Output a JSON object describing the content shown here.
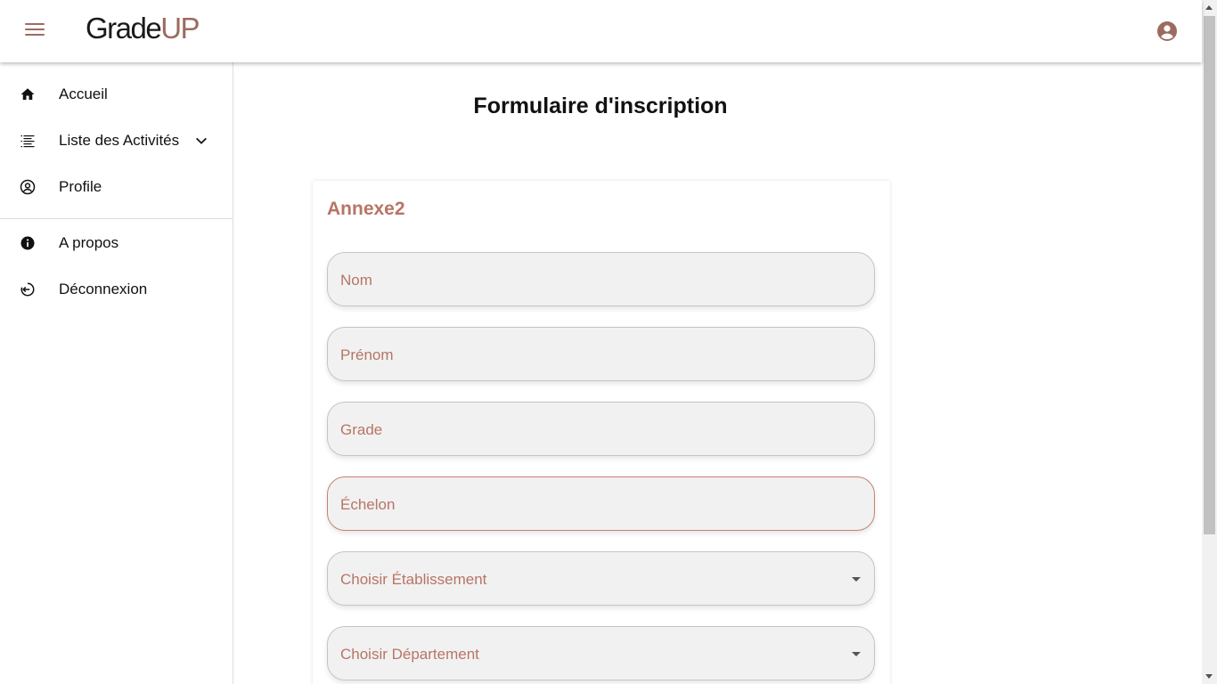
{
  "header": {
    "logo_part1": "Grade",
    "logo_part2": "UP",
    "menu_icon": "hamburger-menu-icon",
    "account_icon": "account-circle-icon"
  },
  "sidebar": {
    "items": [
      {
        "label": "Accueil",
        "icon": "home-icon"
      },
      {
        "label": "Liste des Activités",
        "icon": "list-icon",
        "expand_icon": "chevron-down-icon"
      },
      {
        "label": "Profile",
        "icon": "account-circle-outline-icon"
      },
      {
        "label": "A propos",
        "icon": "info-icon"
      },
      {
        "label": "Déconnexion",
        "icon": "logout-icon"
      }
    ]
  },
  "main": {
    "title": "Formulaire d'inscription",
    "card": {
      "title": "Annexe2",
      "fields": [
        {
          "placeholder": "Nom",
          "type": "text"
        },
        {
          "placeholder": "Prénom",
          "type": "text"
        },
        {
          "placeholder": "Grade",
          "type": "text"
        },
        {
          "placeholder": "Échelon",
          "type": "text"
        },
        {
          "placeholder": "Choisir Établissement",
          "type": "select"
        },
        {
          "placeholder": "Choisir Département",
          "type": "select"
        }
      ]
    }
  },
  "colors": {
    "accent": "#b67566",
    "brand": "#9c6b60",
    "field_bg": "#f2f1f1"
  }
}
